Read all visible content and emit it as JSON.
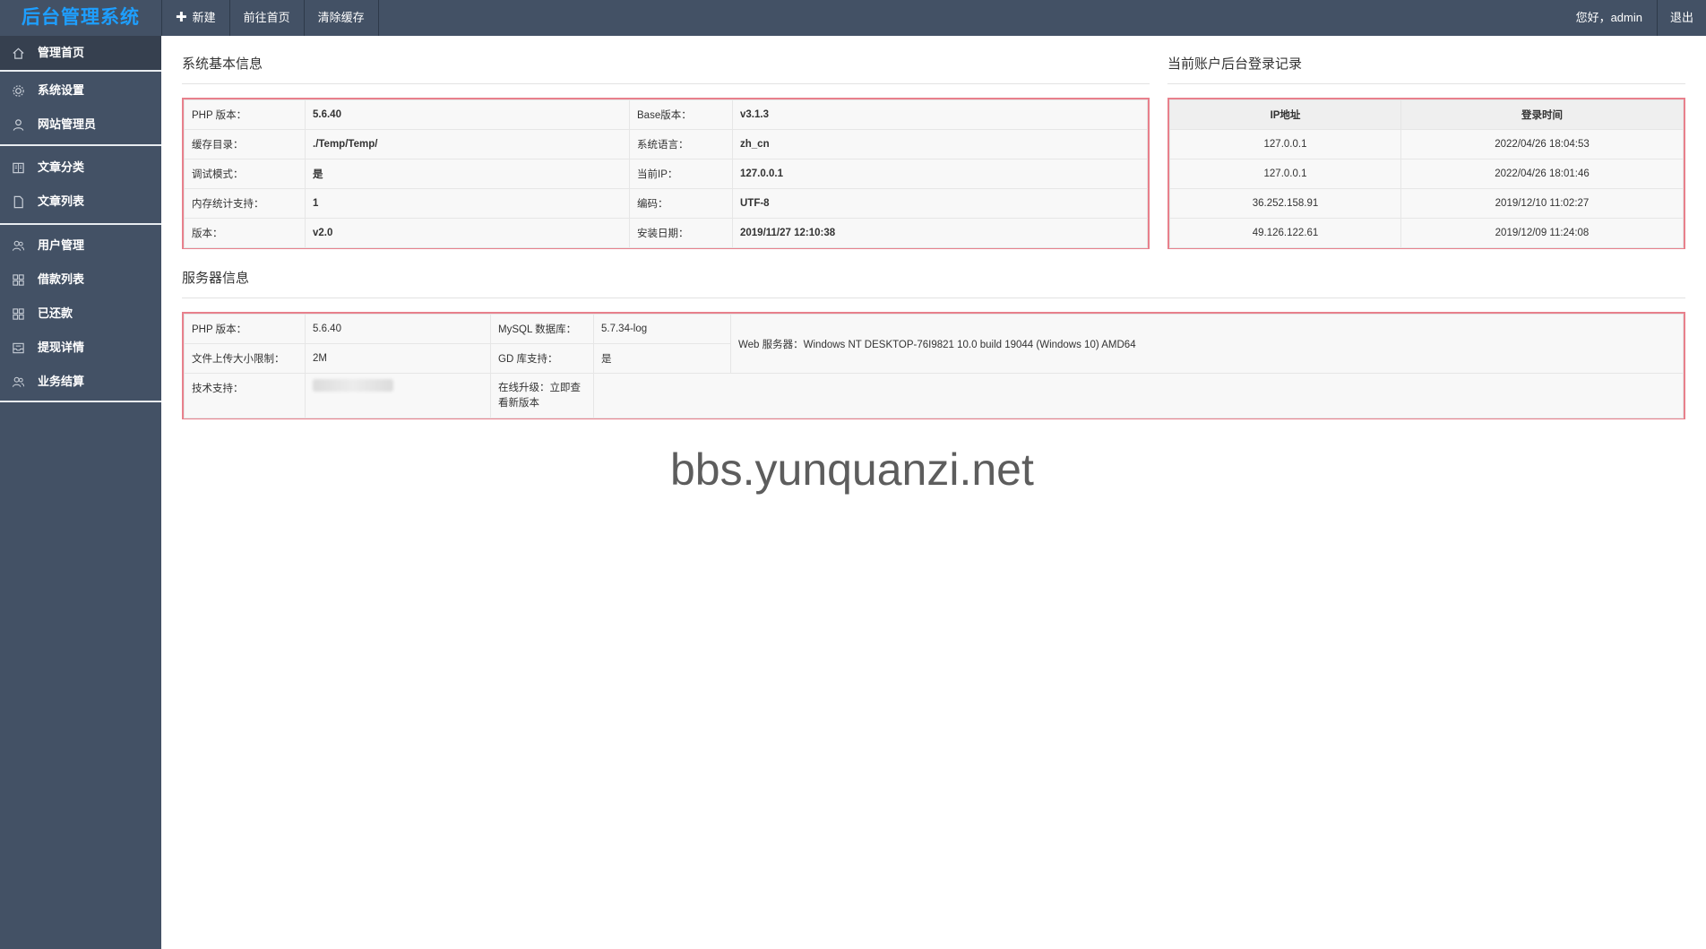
{
  "app": {
    "brand": "后台管理系统"
  },
  "top_nav": {
    "new": "新建",
    "home": "前往首页",
    "clear_cache": "清除缓存"
  },
  "user": {
    "greeting": "您好，admin",
    "logout": "退出"
  },
  "sidebar": {
    "items": [
      {
        "label": "管理首页",
        "icon": "home-icon"
      },
      {
        "label": "系统设置",
        "icon": "gear-icon"
      },
      {
        "label": "网站管理员",
        "icon": "user-icon"
      },
      {
        "label": "文章分类",
        "icon": "book-icon"
      },
      {
        "label": "文章列表",
        "icon": "document-icon"
      },
      {
        "label": "用户管理",
        "icon": "users-icon"
      },
      {
        "label": "借款列表",
        "icon": "grid-icon"
      },
      {
        "label": "已还款",
        "icon": "grid-icon"
      },
      {
        "label": "提现详情",
        "icon": "inbox-icon"
      },
      {
        "label": "业务结算",
        "icon": "users-icon"
      }
    ]
  },
  "system_info": {
    "title": "系统基本信息",
    "rows": [
      [
        "PHP 版本：",
        "5.6.40",
        "Base版本：",
        "v3.1.3"
      ],
      [
        "缓存目录：",
        "./Temp/Temp/",
        "系统语言：",
        "zh_cn"
      ],
      [
        "调试模式：",
        "是",
        "当前IP：",
        "127.0.0.1"
      ],
      [
        "内存统计支持：",
        "1",
        "编码：",
        "UTF-8"
      ],
      [
        "版本：",
        "v2.0",
        "安装日期：",
        "2019/11/27 12:10:38"
      ]
    ]
  },
  "login_log": {
    "title": "当前账户后台登录记录",
    "headers": [
      "IP地址",
      "登录时间"
    ],
    "rows": [
      [
        "127.0.0.1",
        "2022/04/26 18:04:53"
      ],
      [
        "127.0.0.1",
        "2022/04/26 18:01:46"
      ],
      [
        "36.252.158.91",
        "2019/12/10 11:02:27"
      ],
      [
        "49.126.122.61",
        "2019/12/09 11:24:08"
      ]
    ]
  },
  "server_info": {
    "title": "服务器信息",
    "php_label": "PHP 版本：",
    "php_value": "5.6.40",
    "mysql_label": "MySQL 数据库：",
    "mysql_value": "5.7.34-log",
    "upload_label": "文件上传大小限制：",
    "upload_value": "2M",
    "gd_label": "GD 库支持：",
    "gd_value": "是",
    "web_server": "Web 服务器：Windows NT DESKTOP-76I9821 10.0 build 19044 (Windows 10) AMD64",
    "support_label": "技术支持：",
    "upgrade_label": "在线升级：立即查看新版本"
  },
  "watermark": "bbs.yunquanzi.net",
  "colors": {
    "topbar": "#435165",
    "brand": "#1e9fff",
    "highlight_border": "#e8808c"
  }
}
